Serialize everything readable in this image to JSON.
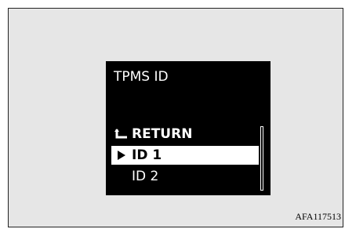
{
  "display": {
    "title": "TPMS ID",
    "menu": [
      {
        "label": "RETURN",
        "icon": "return-arrow-icon"
      },
      {
        "label": "ID 1",
        "icon": "play-triangle-icon",
        "selected": true
      },
      {
        "label": "ID 2"
      }
    ]
  },
  "figure_ref": "AFA117513"
}
